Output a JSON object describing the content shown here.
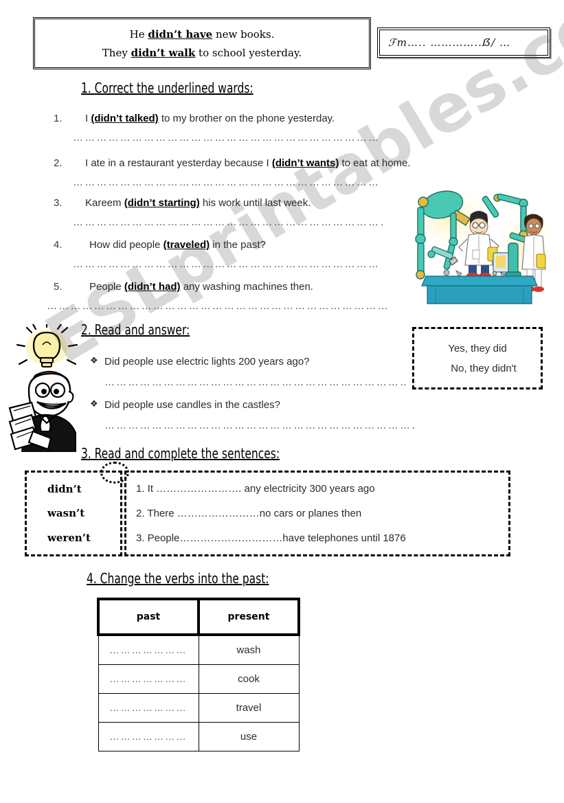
{
  "header": {
    "example_box": {
      "lines": [
        {
          "prefix": "He ",
          "bold": "didn’t have",
          "suffix": " new books."
        },
        {
          "prefix": "They ",
          "bold": "didn’t walk",
          "suffix": " to school yesterday."
        }
      ]
    },
    "name_date_line": "ℱm….. …………..ẞ/ …"
  },
  "sections": [
    {
      "id": "section-1",
      "heading": "1. Correct the underlined wards:",
      "items": [
        {
          "num": "1.",
          "pre": "I ",
          "bold": "(didn’t talked)",
          "post": " to my brother on the phone yesterday."
        },
        {
          "num": "2.",
          "pre": "I ate in a restaurant yesterday because I ",
          "bold": "(didn’t wants)",
          "post": " to eat at home."
        },
        {
          "num": "3.",
          "pre": "Kareem ",
          "bold": "(didn’t starting)",
          "post": " his work until last week."
        },
        {
          "num": "4.",
          "pre": "How did people ",
          "bold": "(traveled)",
          "post": " in the past?"
        },
        {
          "num": "5.",
          "pre": "People ",
          "bold": "(didn’t had)",
          "post": " any washing machines then."
        }
      ]
    },
    {
      "id": "section-2",
      "heading": "2. Read and answer:",
      "bullet_glyph": "❖",
      "questions": [
        "Did people use electric lights 200 years ago?",
        "Did people use candles in the castles?"
      ],
      "answer_box": {
        "line1": "Yes, they did",
        "line2": "No, they didn't"
      }
    },
    {
      "id": "section-3",
      "heading": "3. Read and complete the sentences:",
      "word_bank": [
        "didn’t",
        "wasn’t",
        "weren’t"
      ],
      "sentences": [
        "1.  It ……………………. any electricity 300 years ago",
        "2.  There ……………………no cars or planes then",
        "3.  People…………………………have telephones until 1876"
      ]
    },
    {
      "id": "section-4",
      "heading": "4. Change the verbs into the past:",
      "table": {
        "columns": [
          "past",
          "present"
        ],
        "rows": [
          {
            "past": "…………………",
            "present": "wash"
          },
          {
            "past": "…………………",
            "present": "cook"
          },
          {
            "past": "…………………",
            "present": "travel"
          },
          {
            "past": "…………………",
            "present": "use"
          }
        ]
      }
    }
  ],
  "answer_lines": {
    "text": "………………………………………………………………………………"
  },
  "watermark": {
    "text": "ESLprintables.com",
    "color": "#3c3c3c"
  },
  "illustrations": {
    "robot": "robotics-lab-scientist-illustration",
    "idea": "man-with-lightbulb-idea-illustration"
  },
  "colors": {
    "ink": "#000000",
    "body_text": "#2b2b2b",
    "dots": "#4a4a4a",
    "robot_teal": "#3fc6b0",
    "robot_blue": "#1f9fc4",
    "bulb_yellow": "#f6e27a",
    "skin": "#f6d7b0"
  }
}
